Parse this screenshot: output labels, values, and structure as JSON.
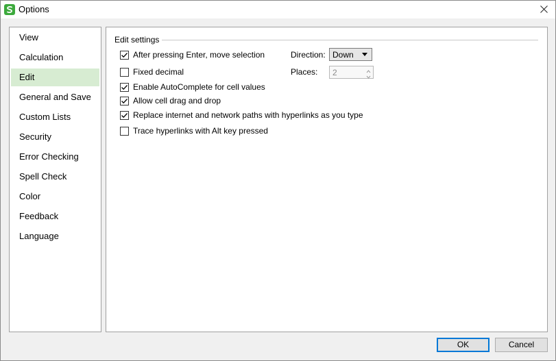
{
  "window": {
    "title": "Options",
    "icon": "wps-spreadsheet-icon",
    "accent_color": "#3daa3d"
  },
  "sidebar": {
    "items": [
      {
        "label": "View",
        "active": false
      },
      {
        "label": "Calculation",
        "active": false
      },
      {
        "label": "Edit",
        "active": true
      },
      {
        "label": "General and Save",
        "active": false
      },
      {
        "label": "Custom Lists",
        "active": false
      },
      {
        "label": "Security",
        "active": false
      },
      {
        "label": "Error Checking",
        "active": false
      },
      {
        "label": "Spell Check",
        "active": false
      },
      {
        "label": "Color",
        "active": false
      },
      {
        "label": "Feedback",
        "active": false
      },
      {
        "label": "Language",
        "active": false
      }
    ],
    "active_color": "#d7ecd2"
  },
  "edit_settings": {
    "group_title": "Edit settings",
    "options": [
      {
        "label": "After pressing Enter, move selection",
        "checked": true
      },
      {
        "label": "Fixed decimal",
        "checked": false
      },
      {
        "label": "Enable AutoComplete for cell values",
        "checked": true
      },
      {
        "label": "Allow cell drag and drop",
        "checked": true
      },
      {
        "label": "Replace internet and network paths with hyperlinks as you type",
        "checked": true
      },
      {
        "label": "Trace hyperlinks with Alt key pressed",
        "checked": false
      }
    ],
    "direction": {
      "label": "Direction:",
      "value": "Down"
    },
    "places": {
      "label": "Places:",
      "value": "2",
      "enabled": false
    }
  },
  "footer": {
    "ok_label": "OK",
    "cancel_label": "Cancel"
  }
}
